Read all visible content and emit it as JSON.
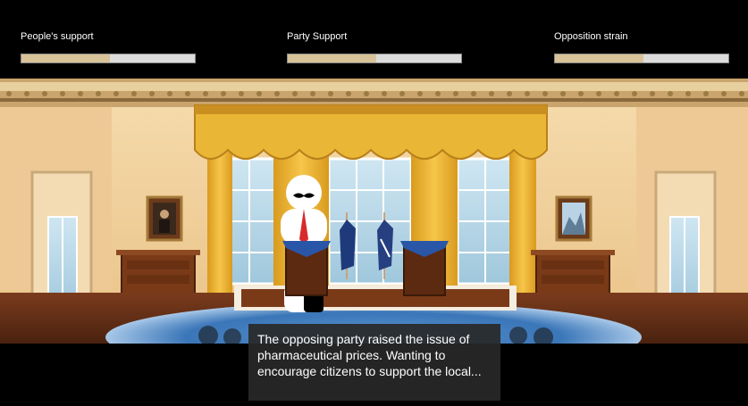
{
  "meters": [
    {
      "label": "People's support",
      "level_percent": 51
    },
    {
      "label": "Party Support",
      "level_percent": 51
    },
    {
      "label": "Opposition strain",
      "level_percent": 51
    }
  ],
  "dialogue": {
    "text": "The opposing party raised the issue of pharmaceutical prices. Wanting to encourage citizens to support the local..."
  },
  "colors": {
    "meter_fill": "#d8c398",
    "meter_track": "#dcdcdc",
    "curtain": "#e8b233",
    "carpet": "#3a76b8",
    "wall": "#f2d3a0"
  }
}
